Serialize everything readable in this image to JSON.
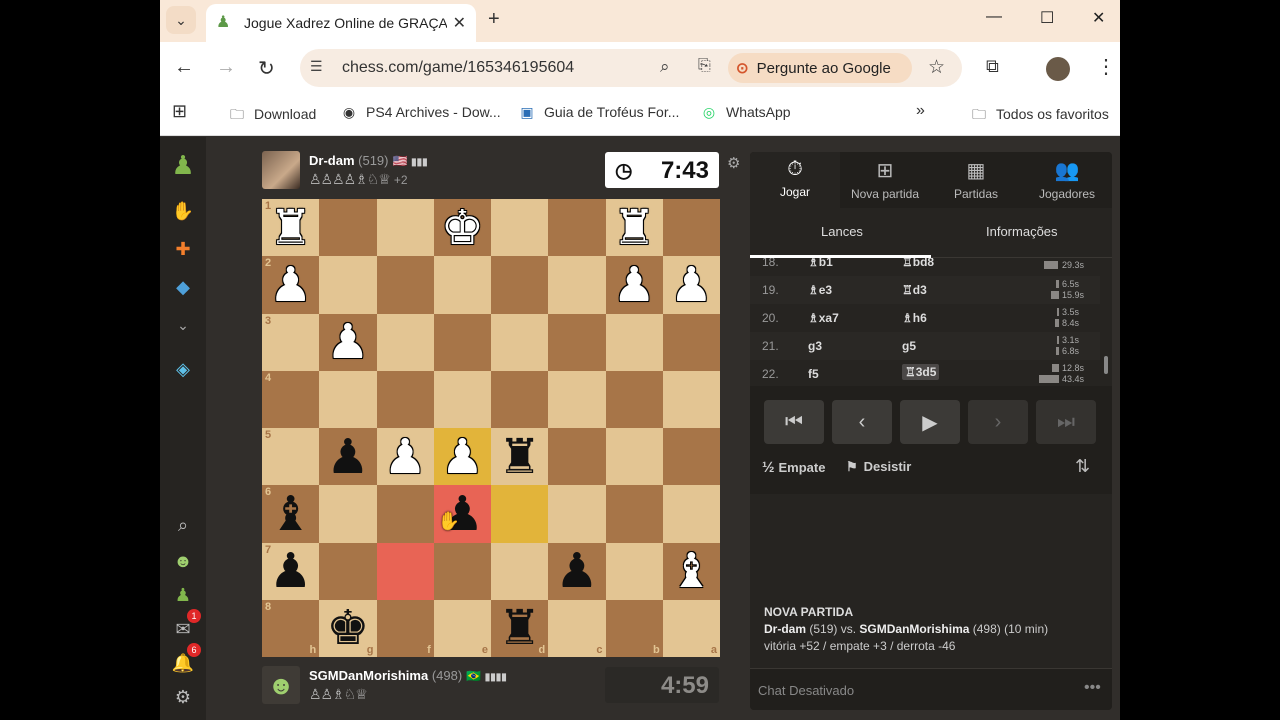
{
  "browser": {
    "tab_title": "Jogue Xadrez Online de GRAÇA",
    "url": "chess.com/game/165346195604",
    "ask_google": "Pergunte ao Google",
    "bookmarks": [
      "Download",
      "PS4 Archives - Dow...",
      "Guia de Troféus For...",
      "WhatsApp"
    ],
    "bookmarks_overflow": "»",
    "all_bookmarks": "Todos os favoritos"
  },
  "sidebar": {
    "badge_messages": "1",
    "badge_notifications": "6"
  },
  "top_player": {
    "name": "Dr-dam",
    "rating": "(519)",
    "flag": "🇺🇸",
    "captured": "♙♙♙♙♗♘♕",
    "advantage": "+2",
    "clock": "7:43"
  },
  "bottom_player": {
    "name": "SGMDanMorishima",
    "rating": "(498)",
    "flag": "🇧🇷",
    "captured": "♙♙♗♘♕",
    "clock": "4:59"
  },
  "board": {
    "ranks": [
      "1",
      "2",
      "3",
      "4",
      "5",
      "6",
      "7",
      "8"
    ],
    "files": [
      "h",
      "g",
      "f",
      "e",
      "d",
      "c",
      "b",
      "a"
    ],
    "colors": {
      "light": "#e3c593",
      "dark": "#a77548",
      "last_move_yellow": "#e2b43a",
      "highlight_red": "#e86455"
    }
  },
  "panel": {
    "nav": [
      {
        "label": "Jogar",
        "icon": "⏱"
      },
      {
        "label": "Nova partida",
        "icon": "⊞"
      },
      {
        "label": "Partidas",
        "icon": "▦"
      },
      {
        "label": "Jogadores",
        "icon": "👥"
      }
    ],
    "subtabs": [
      "Lances",
      "Informações"
    ],
    "moves": [
      {
        "n": "18.",
        "w": "♗b1",
        "b": "♖bd8",
        "wt": "",
        "bt": "29.3s"
      },
      {
        "n": "19.",
        "w": "♗e3",
        "b": "♖d3",
        "wt": "6.5s",
        "bt": "15.9s"
      },
      {
        "n": "20.",
        "w": "♗xa7",
        "b": "♗h6",
        "wt": "3.5s",
        "bt": "8.4s"
      },
      {
        "n": "21.",
        "w": "g3",
        "b": "g5",
        "wt": "3.1s",
        "bt": "6.8s"
      },
      {
        "n": "22.",
        "w": "f5",
        "b": "♖3d5",
        "wt": "12.8s",
        "bt": "43.4s"
      }
    ],
    "draw": "Empate",
    "draw_icon": "½",
    "resign": "Desistir",
    "game_info": {
      "heading": "NOVA PARTIDA",
      "white": "Dr-dam",
      "white_rating": "(519)",
      "vs": "vs.",
      "black": "SGMDanMorishima",
      "black_rating": "(498)",
      "time": "(10 min)",
      "stakes": "vitória +52 / empate +3 / derrota -46"
    },
    "chat": "Chat Desativado"
  }
}
